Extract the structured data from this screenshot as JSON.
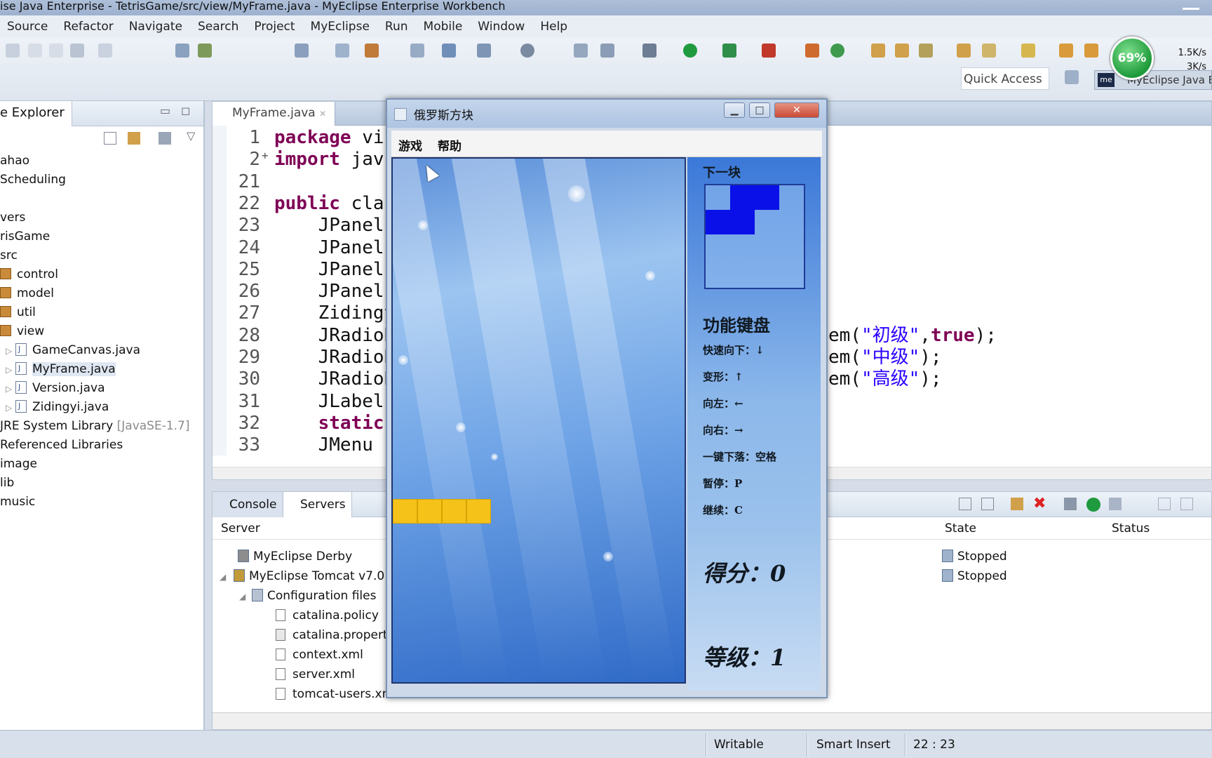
{
  "window": {
    "title": "ise Java Enterprise - TetrisGame/src/view/MyFrame.java - MyEclipse Enterprise Workbench"
  },
  "menubar": [
    "Source",
    "Refactor",
    "Navigate",
    "Search",
    "Project",
    "MyEclipse",
    "Run",
    "Mobile",
    "Window",
    "Help"
  ],
  "toolbar": {
    "quick_access": "Quick Access",
    "cpu_percent": "69%",
    "upload_speed": "1.5K/s",
    "download_speed": "3K/s",
    "perspective_label": "MyEclipse Java E",
    "perspective_badge": "me"
  },
  "explorer": {
    "tab_label": "e Explorer",
    "items": [
      {
        "label": "ahao"
      },
      {
        "label": "Scheduling"
      },
      {
        "label": "vers"
      },
      {
        "label": "risGame"
      },
      {
        "label": "src"
      },
      {
        "label": "control"
      },
      {
        "label": "model"
      },
      {
        "label": "util"
      },
      {
        "label": "view"
      },
      {
        "label": "GameCanvas.java"
      },
      {
        "label": "MyFrame.java"
      },
      {
        "label": "Version.java"
      },
      {
        "label": "Zidingyi.java"
      },
      {
        "label": "JRE System Library",
        "suffix": "[JavaSE-1.7]"
      },
      {
        "label": "Referenced Libraries"
      },
      {
        "label": "image"
      },
      {
        "label": "lib"
      },
      {
        "label": "music"
      }
    ]
  },
  "editor": {
    "tab_label": "MyFrame.java",
    "lines": [
      {
        "num": "1",
        "kw": "package",
        "rest": " vi"
      },
      {
        "num": "2",
        "marker": "+",
        "kw": "import",
        "rest": " jav"
      },
      {
        "num": "21",
        "kw": "",
        "rest": ""
      },
      {
        "num": "22",
        "kw": "public",
        "rest": " cla"
      },
      {
        "num": "23",
        "kw": "",
        "rest": "    JPanel"
      },
      {
        "num": "24",
        "kw": "",
        "rest": "    JPanel"
      },
      {
        "num": "25",
        "kw": "",
        "rest": "    JPanel"
      },
      {
        "num": "26",
        "kw": "",
        "rest": "    JPanel"
      },
      {
        "num": "27",
        "kw": "",
        "rest": "    Zidingy"
      },
      {
        "num": "28",
        "kw": "",
        "rest": "    JRadioB"
      },
      {
        "num": "29",
        "kw": "",
        "rest": "    JRadioB"
      },
      {
        "num": "30",
        "kw": "",
        "rest": "    JRadioB"
      },
      {
        "num": "31",
        "kw": "",
        "rest": "    JLabel"
      },
      {
        "num": "32",
        "kw": "    static",
        "rest": ""
      },
      {
        "num": "33",
        "kw": "",
        "rest": "    JMenu r"
      }
    ],
    "right_fragments": [
      {
        "pre": "em(",
        "str": "\"初级\"",
        "mid": ",",
        "kw": "true",
        "post": ");"
      },
      {
        "pre": "em(",
        "str": "\"中级\"",
        "mid": "",
        "kw": "",
        "post": ");"
      },
      {
        "pre": "em(",
        "str": "\"高级\"",
        "mid": "",
        "kw": "",
        "post": ");"
      }
    ]
  },
  "servers_view": {
    "tabs": [
      "Console",
      "Servers"
    ],
    "columns": {
      "server": "Server",
      "state": "State",
      "status": "Status"
    },
    "rows": [
      {
        "label": "MyEclipse Derby",
        "state": "Stopped"
      },
      {
        "label": "MyEclipse Tomcat v7.0",
        "state": "Stopped"
      },
      {
        "label": "Configuration files",
        "state": ""
      },
      {
        "label": "catalina.policy",
        "state": ""
      },
      {
        "label": "catalina.properties",
        "state": ""
      },
      {
        "label": "context.xml",
        "state": ""
      },
      {
        "label": "server.xml",
        "state": ""
      },
      {
        "label": "tomcat-users.xml",
        "state": ""
      }
    ]
  },
  "statusbar": {
    "writable": "Writable",
    "insert_mode": "Smart Insert",
    "position": "22 : 23"
  },
  "tetris": {
    "title": "俄罗斯方块",
    "menu": [
      "游戏",
      "帮助"
    ],
    "next_label": "下一块",
    "keys_title": "功能键盘",
    "keys": [
      "快速向下：↓",
      "变形：↑",
      "向左：←",
      "向右：→",
      "一键下落：空格",
      "暂停：P",
      "继续：C"
    ],
    "score_label": "得分：0",
    "level_label": "等级：1",
    "colors": {
      "falling_piece": "#f5c21a",
      "next_piece": "#0a10e8"
    }
  },
  "watermark": "",
  "colors": {
    "keyword": "#7f0055",
    "string": "#2a00ff"
  }
}
